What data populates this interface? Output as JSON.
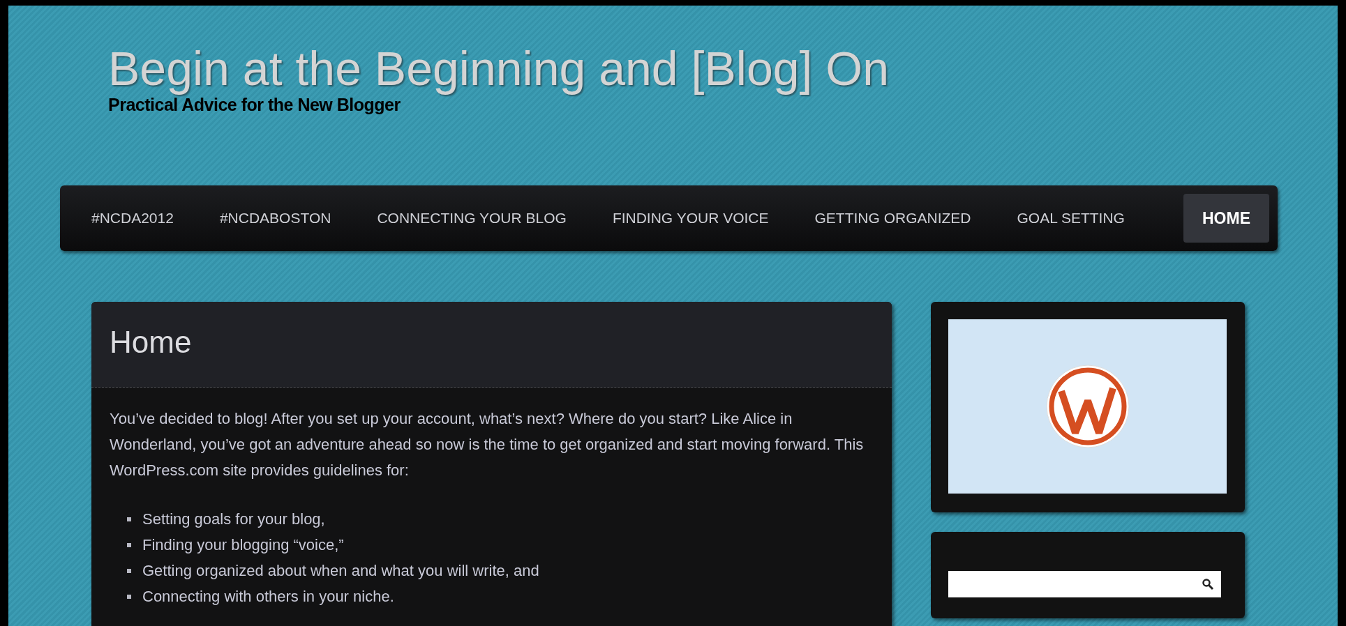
{
  "site": {
    "title": "Begin at the Beginning and [Blog] On",
    "tagline": "Practical Advice for the New Blogger"
  },
  "nav": [
    {
      "label": "#NCDA2012",
      "selected": false
    },
    {
      "label": "#NCDABOSTON",
      "selected": false
    },
    {
      "label": "CONNECTING YOUR BLOG",
      "selected": false
    },
    {
      "label": "FINDING YOUR VOICE",
      "selected": false
    },
    {
      "label": "GETTING ORGANIZED",
      "selected": false
    },
    {
      "label": "GOAL SETTING",
      "selected": false
    },
    {
      "label": "HOME",
      "selected": true
    }
  ],
  "page": {
    "heading": "Home",
    "intro": "You’ve decided to blog! After you set up your account, what’s next? Where do you start? Like Alice in Wonderland, you’ve got an adventure ahead so now is the time to get organized and start moving forward. This WordPress.com site provides guidelines for:",
    "list": [
      "Setting goals for your blog,",
      "Finding your blogging “voice,”",
      "Getting organized about when and what you will write, and",
      "Connecting with others in your niche."
    ]
  }
}
